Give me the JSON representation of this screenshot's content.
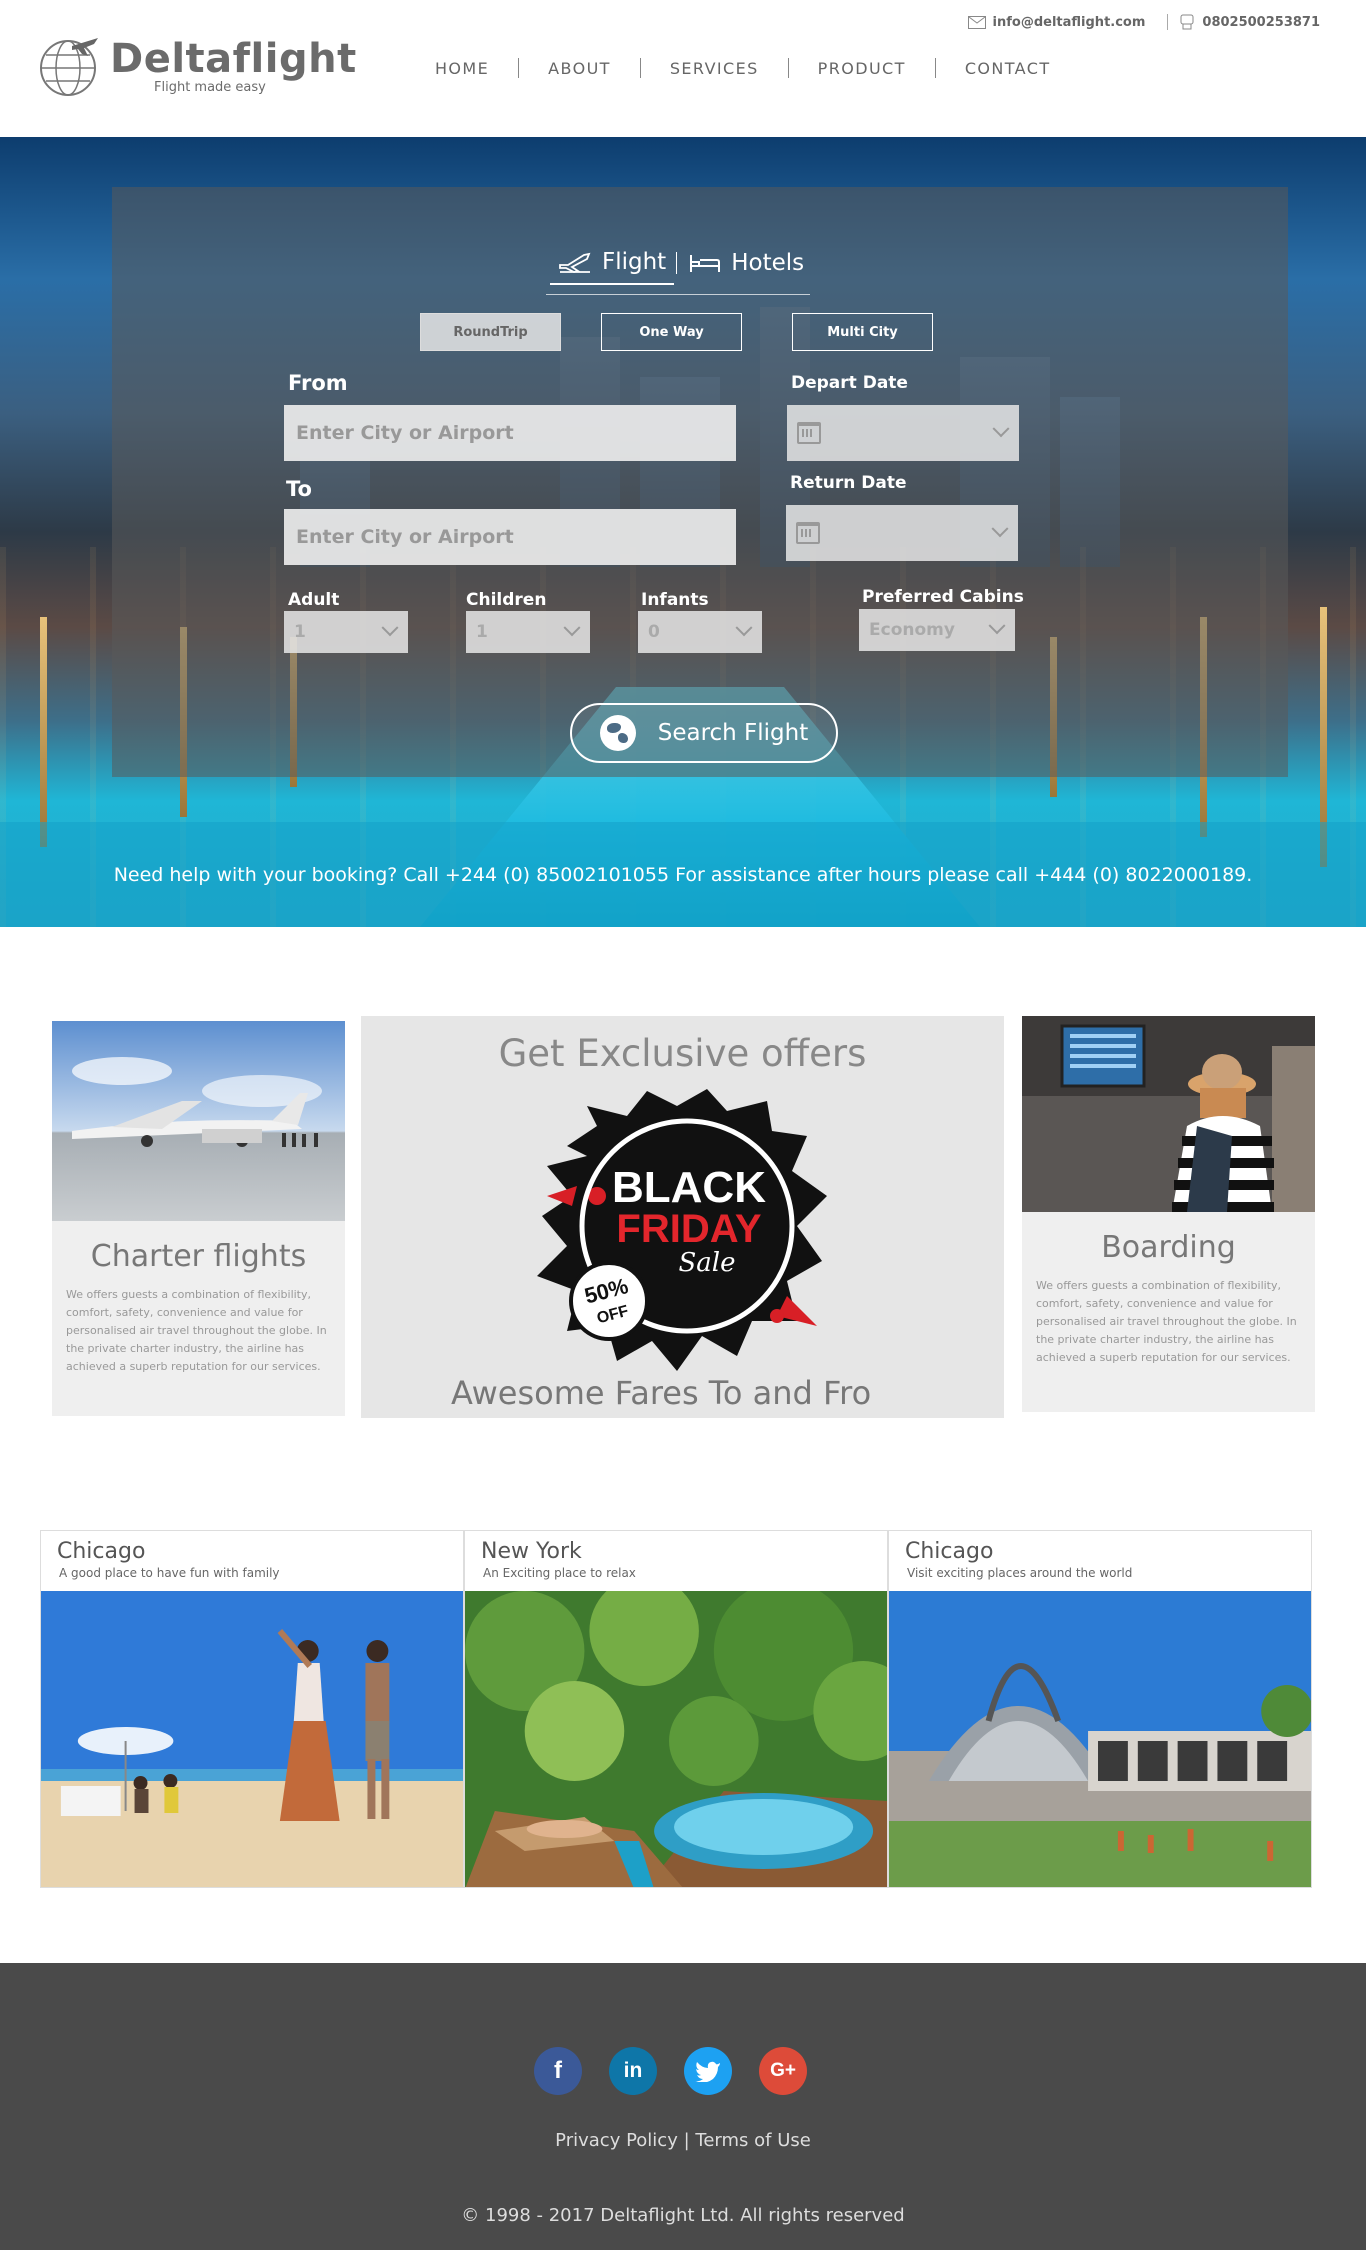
{
  "header": {
    "email": "info@deltaflight.com",
    "phone": "0802500253871",
    "logo_name": "Deltaflight",
    "logo_tagline": "Flight made easy",
    "nav": [
      "HOME",
      "ABOUT",
      "SERVICES",
      "PRODUCT",
      "CONTACT"
    ]
  },
  "search": {
    "tabs": [
      "Flight",
      "Hotels"
    ],
    "trip_types": [
      "RoundTrip",
      "One Way",
      "Multi City"
    ],
    "from_label": "From",
    "from_placeholder": "Enter City or Airport",
    "to_label": "To",
    "to_placeholder": "Enter City or Airport",
    "depart_label": "Depart Date",
    "return_label": "Return Date",
    "adult_label": "Adult",
    "adult_value": "1",
    "children_label": "Children",
    "children_value": "1",
    "infants_label": "Infants",
    "infants_value": "0",
    "cabin_label": "Preferred Cabins",
    "cabin_value": "Economy",
    "button": "Search Flight"
  },
  "help_text": "Need help with your booking? Call  +244 (0) 85002101055 For assistance after hours please call +444 (0) 8022000189.",
  "offers": {
    "charter_title": "Charter flights",
    "charter_desc": "We offers guests a combination of flexibility, comfort, safety, convenience and value for personalised air travel throughout the globe. In the private charter industry, the airline has achieved a superb reputation for our services.",
    "exclusive_title": "Get Exclusive offers",
    "promo_line1": "BLACK",
    "promo_line2": "FRIDAY",
    "promo_line3": "Sale",
    "promo_badge_pct": "50%",
    "promo_badge_off": "OFF",
    "exclusive_footer": "Awesome Fares To and Fro",
    "boarding_title": "Boarding",
    "boarding_desc": "We offers guests a combination of flexibility, comfort, safety, convenience and value for personalised air travel throughout the globe. In the private charter industry, the airline has achieved a superb reputation for our services."
  },
  "destinations": [
    {
      "city": "Chicago",
      "subtitle": "A good place to have fun with family"
    },
    {
      "city": "New York",
      "subtitle": "An Exciting place to relax"
    },
    {
      "city": "Chicago",
      "subtitle": "Visit exciting places around the world"
    }
  ],
  "footer": {
    "social": [
      "facebook-icon",
      "linkedin-icon",
      "twitter-icon",
      "google-plus-icon"
    ],
    "privacy": "Privacy Policy",
    "link_sep": "|",
    "terms": "Terms of Use",
    "copyright": "© 1998 - 2017 Deltaflight Ltd. All rights reserved"
  },
  "colors": {
    "facebook": "#3b5998",
    "linkedin": "#0e76a8",
    "twitter": "#1da1f2",
    "googleplus": "#dd4b39",
    "footer_bg": "#4a4a4a"
  }
}
